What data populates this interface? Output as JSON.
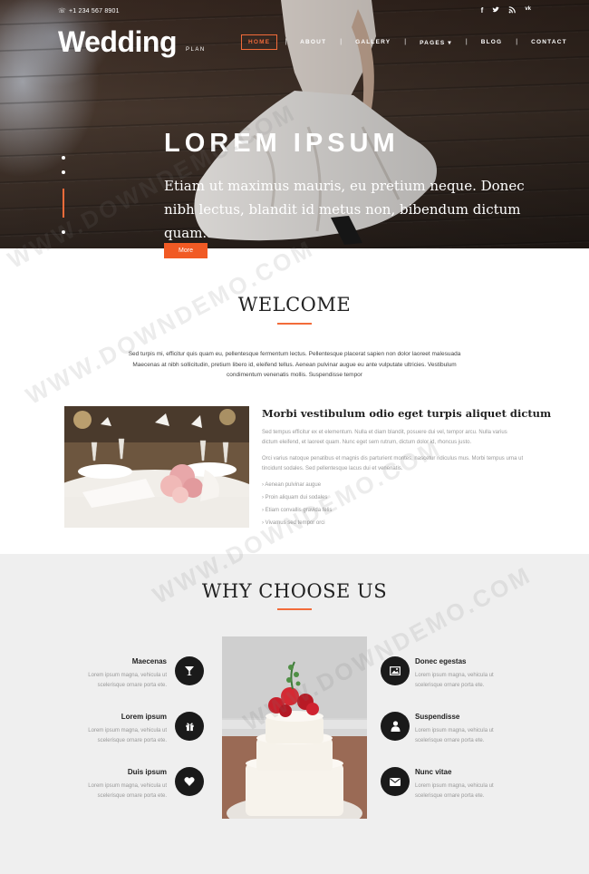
{
  "topbar": {
    "phone": "+1 234 567 8901",
    "social": [
      "f",
      "t",
      "rss",
      "vk"
    ]
  },
  "brand": {
    "name": "Wedding",
    "sub": "PLAN"
  },
  "nav": {
    "items": [
      "HOME",
      "ABOUT",
      "GALLERY",
      "PAGES ▾",
      "BLOG",
      "CONTACT"
    ],
    "active": "HOME"
  },
  "hero": {
    "title": "LOREM IPSUM",
    "text": "Etiam ut maximus mauris, eu pretium neque. Donec nibh lectus, blandit id metus non, bibendum dictum quam.",
    "button": "More"
  },
  "welcome": {
    "title": "WELCOME",
    "text": "Sed turpis mi, efficitur quis quam eu, pellentesque fermentum lectus. Pellentesque placerat sapien non dolor laoreet malesuada Maecenas at nibh sollicitudin, pretium libero id, eleifend tellus. Aenean pulvinar augue eu ante vulputate ultricies. Vestibulum condimentum venenatis mollis. Suspendisse tempor",
    "feature": {
      "title": "Morbi vestibulum odio eget turpis aliquet dictum",
      "p1": "Sed tempus efficitur ex et elementum. Nulla et diam blandit, posuere dui vel, tempor arcu. Nulla varius dictum eleifend, et laoreet quam. Nunc eget sem rutrum, dictum dolor id, rhoncus justo.",
      "p2": "Orci varius natoque penatibus et magnis dis parturient montes, nascetur ridiculus mus. Morbi tempus urna ut tincidunt sodales. Sed pellentesque lacus dui et venenatis.",
      "list": [
        "Aenean pulvinar augue",
        "Proin aliquam dui sodales",
        "Etiam convallis gravida felis",
        "Vivamus sed tempor orci"
      ]
    }
  },
  "why": {
    "title": "WHY CHOOSE US",
    "item_text": "Lorem ipsum magna, vehicula ut scelerisque ornare porta ete.",
    "left": [
      {
        "title": "Maecenas",
        "icon": "cocktail-glass-icon"
      },
      {
        "title": "Lorem ipsum",
        "icon": "gift-icon"
      },
      {
        "title": "Duis ipsum",
        "icon": "heart-icon"
      }
    ],
    "right": [
      {
        "title": "Donec egestas",
        "icon": "picture-icon"
      },
      {
        "title": "Suspendisse",
        "icon": "user-icon"
      },
      {
        "title": "Nunc vitae",
        "icon": "envelope-icon"
      }
    ]
  },
  "colors": {
    "accent": "#f26b3a",
    "button": "#f15a24",
    "icon_bg": "#1a1a1a",
    "section_bg": "#efefef"
  },
  "watermark": "WWW.DOWNDEMO.COM"
}
